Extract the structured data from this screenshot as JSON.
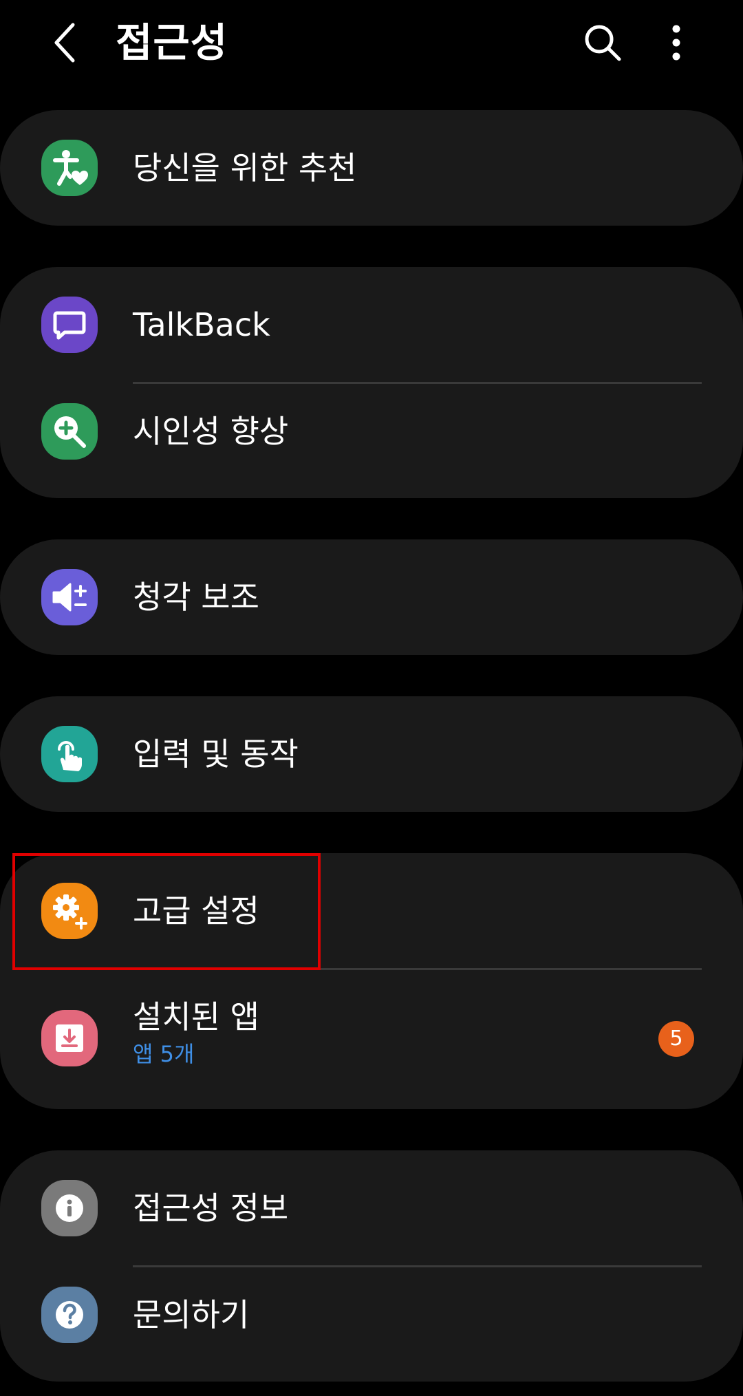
{
  "header": {
    "title": "접근성",
    "back_icon": "chevron-left-icon",
    "search_icon": "search-icon",
    "more_icon": "more-vertical-icon"
  },
  "sections": [
    {
      "items": [
        {
          "label": "당신을 위한 추천",
          "icon": "accessibility-heart-icon",
          "icon_color": "#2e9b5a"
        }
      ]
    },
    {
      "items": [
        {
          "label": "TalkBack",
          "icon": "talkback-icon",
          "icon_color": "#6b47c8"
        },
        {
          "label": "시인성 향상",
          "icon": "zoom-in-icon",
          "icon_color": "#2e9b5a"
        }
      ]
    },
    {
      "items": [
        {
          "label": "청각 보조",
          "icon": "volume-plus-minus-icon",
          "icon_color": "#6a5ed9"
        }
      ]
    },
    {
      "items": [
        {
          "label": "입력 및 동작",
          "icon": "touch-hand-icon",
          "icon_color": "#22a596"
        }
      ]
    },
    {
      "items": [
        {
          "label": "고급 설정",
          "icon": "gear-plus-icon",
          "icon_color": "#f28a12",
          "highlighted": true
        },
        {
          "label": "설치된 앱",
          "sublabel": "앱 5개",
          "badge": "5",
          "icon": "download-icon",
          "icon_color": "#e2687c"
        }
      ]
    },
    {
      "items": [
        {
          "label": "접근성 정보",
          "icon": "info-icon",
          "icon_color": "#7a7a7a"
        },
        {
          "label": "문의하기",
          "icon": "question-icon",
          "icon_color": "#5b7fa3"
        }
      ]
    }
  ],
  "colors": {
    "background": "#000000",
    "card": "#1a1a1a",
    "sublabel": "#3f8fe6",
    "badge": "#e8611b",
    "highlight": "#e00000"
  }
}
